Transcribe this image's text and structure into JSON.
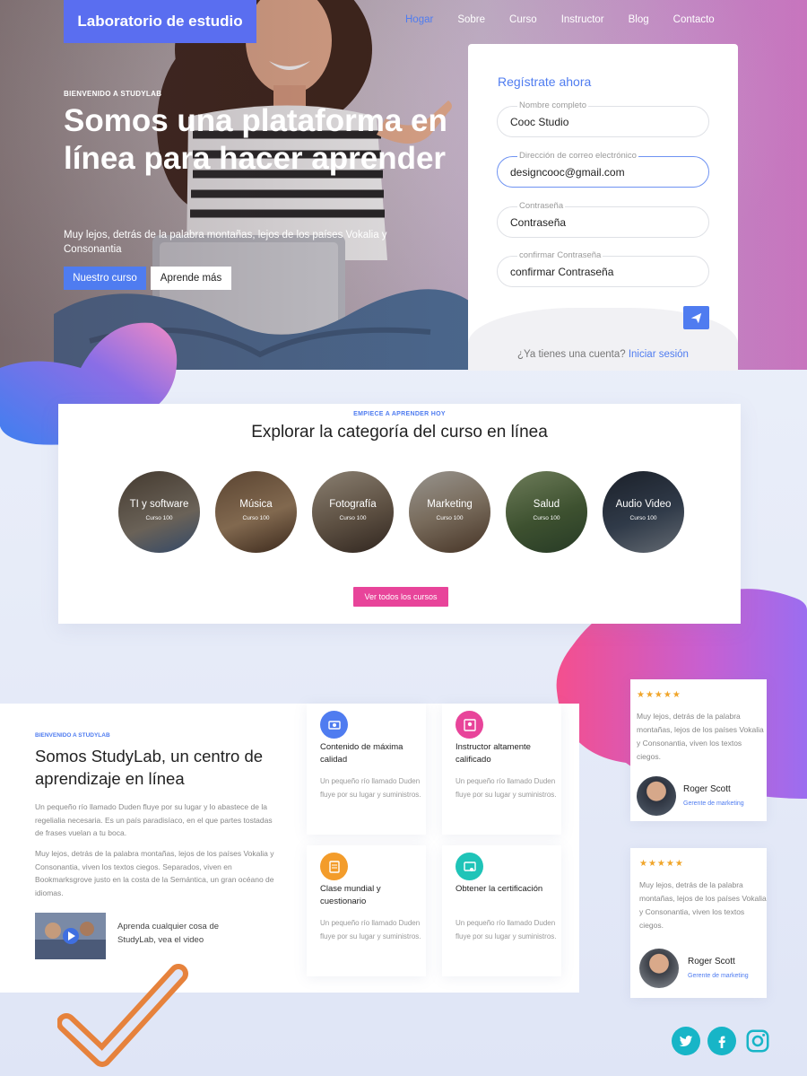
{
  "header": {
    "brand": "Laboratorio de estudio",
    "nav": [
      "Hogar",
      "Sobre",
      "Curso",
      "Instructor",
      "Blog",
      "Contacto"
    ],
    "active_nav": "Hogar"
  },
  "hero": {
    "kicker": "BIENVENIDO A STUDYLAB",
    "title": "Somos una plataforma en línea para hacer aprender",
    "text": "Muy lejos, detrás de la palabra montañas, lejos de los países Vokalia y Consonantia",
    "primary_button": "Nuestro curso",
    "secondary_button": "Aprende más"
  },
  "register": {
    "title": "Regístrate ahora",
    "fields": [
      {
        "label": "Nombre completo",
        "value": "Cooc Studio"
      },
      {
        "label": "Dirección de correo electrónico",
        "value": "designcooc@gmail.com"
      },
      {
        "label": "Contraseña",
        "value": "Contraseña"
      },
      {
        "label": "confirmar Contraseña",
        "value": "confirmar Contraseña"
      }
    ],
    "footer_text": "¿Ya tienes una cuenta?",
    "footer_link": "Iniciar sesión"
  },
  "categories": {
    "kicker": "EMPIECE A APRENDER HOY",
    "title": "Explorar la categoría del curso en línea",
    "items": [
      {
        "title": "TI y software",
        "sub": "Curso 100"
      },
      {
        "title": "Música",
        "sub": "Curso 100"
      },
      {
        "title": "Fotografía",
        "sub": "Curso 100"
      },
      {
        "title": "Marketing",
        "sub": "Curso 100"
      },
      {
        "title": "Salud",
        "sub": "Curso 100"
      },
      {
        "title": "Audio Video",
        "sub": "Curso 100"
      }
    ],
    "button": "Ver todos los cursos"
  },
  "about": {
    "kicker": "BIENVENIDO A STUDYLAB",
    "title": "Somos StudyLab, un centro de aprendizaje en línea",
    "p1": "Un pequeño río llamado Duden fluye por su lugar y lo abastece de la regelialia necesaria. Es un país paradisíaco, en el que partes tostadas de frases vuelan a tu boca.",
    "p2": "Muy lejos, detrás de la palabra montañas, lejos de los países Vokalia y Consonantia, viven los textos ciegos. Separados, viven en Bookmarksgrove justo en la costa de la Semántica, un gran océano de idiomas.",
    "video_text": "Aprenda cualquier cosa de StudyLab, vea el video"
  },
  "features": [
    {
      "title": "Contenido de máxima calidad",
      "text": "Un pequeño río llamado Duden fluye por su lugar y suministros.",
      "icon": "video-icon",
      "color": "#4f7cf0"
    },
    {
      "title": "Instructor altamente calificado",
      "text": "Un pequeño río llamado Duden fluye por su lugar y suministros.",
      "icon": "instructor-icon",
      "color": "#e8449a"
    },
    {
      "title": "Clase mundial y cuestionario",
      "text": "Un pequeño río llamado Duden fluye por su lugar y suministros.",
      "icon": "quiz-icon",
      "color": "#f39c2b"
    },
    {
      "title": "Obtener la certificación",
      "text": "Un pequeño río llamado Duden fluye por su lugar y suministros.",
      "icon": "certificate-icon",
      "color": "#1fc4b8"
    }
  ],
  "testimonials": [
    {
      "stars": "★★★★★",
      "text": "Muy lejos, detrás de la palabra montañas, lejos de los países Vokalia y Consonantia, viven los textos ciegos.",
      "name": "Roger Scott",
      "role": "Gerente de marketing"
    },
    {
      "stars": "★★★★★",
      "text": "Muy lejos, detrás de la palabra montañas, lejos de los países Vokalia y Consonantia, viven los textos ciegos.",
      "name": "Roger Scott",
      "role": "Gerente de marketing"
    }
  ],
  "social": [
    "twitter-icon",
    "facebook-icon",
    "instagram-icon"
  ],
  "colors": {
    "accent": "#4f7cf0",
    "pink": "#e8449a",
    "teal": "#17b5c7"
  }
}
